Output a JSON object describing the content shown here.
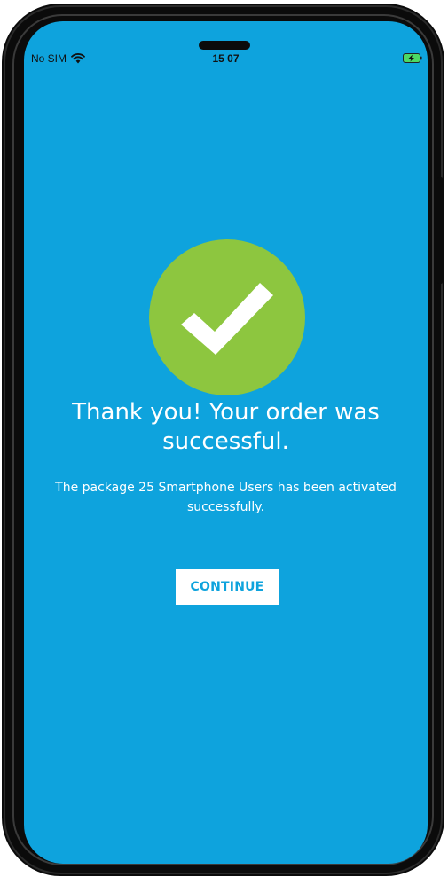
{
  "status_bar": {
    "carrier": "No SIM",
    "time": "15 07",
    "wifi_icon": "wifi-icon",
    "battery_icon": "battery-charging-icon"
  },
  "success": {
    "icon": "checkmark-icon",
    "circle_color": "#8dc63f",
    "headline": "Thank you! Your order was successful.",
    "message": "The package 25 Smartphone Users has been activated successfully."
  },
  "actions": {
    "continue_label": "CONTINUE"
  },
  "colors": {
    "background": "#0ea3dd",
    "accent": "#8dc63f",
    "button_text": "#0ea3dd"
  }
}
